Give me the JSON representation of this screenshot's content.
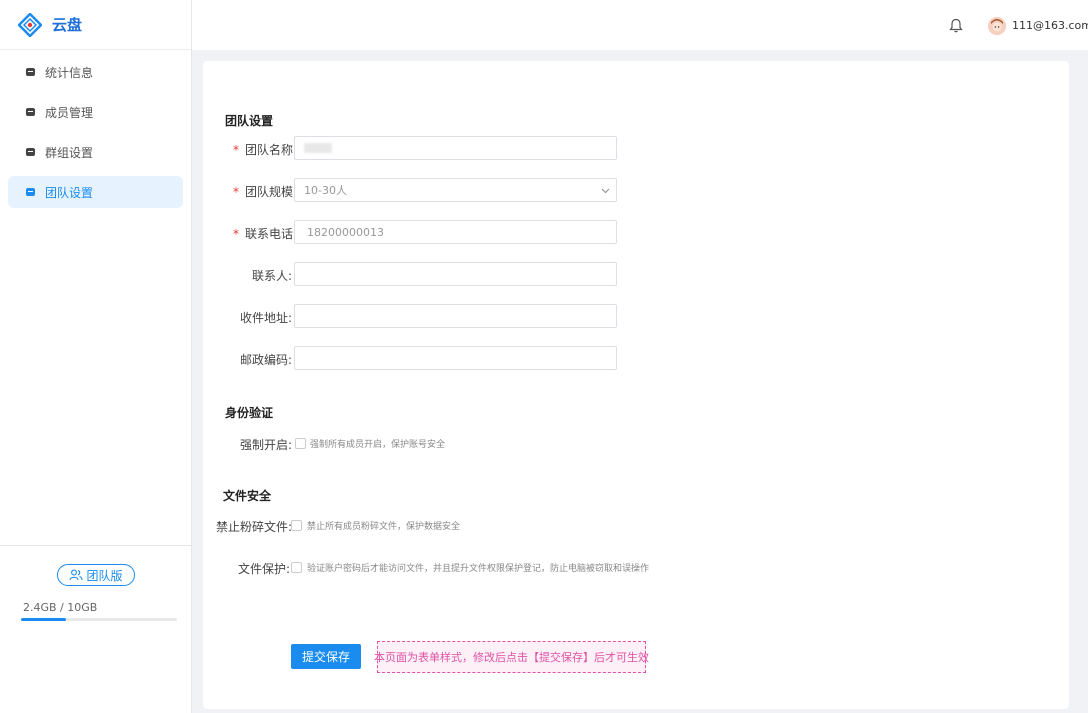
{
  "app": {
    "name": "云盘"
  },
  "sidebar": {
    "items": [
      {
        "label": "统计信息",
        "active": false
      },
      {
        "label": "成员管理",
        "active": false
      },
      {
        "label": "群组设置",
        "active": false
      },
      {
        "label": "团队设置",
        "active": true
      }
    ],
    "team_badge": "团队版",
    "storage_text": "2.4GB / 10GB",
    "storage_used_fraction": 0.29
  },
  "header": {
    "user_email": "111@163.com"
  },
  "form": {
    "section_team": "团队设置",
    "team_name_label": "团队名称:",
    "team_size_label": "团队规模:",
    "team_size_value": "10-30人",
    "phone_label": "联系电话:",
    "phone_value": "18200000013",
    "contact_label": "联系人:",
    "address_label": "收件地址:",
    "postcode_label": "邮政编码:",
    "section_identity": "身份验证",
    "force_enable_label": "强制开启:",
    "force_enable_text": "强制所有成员开启，保护账号安全",
    "section_file": "文件安全",
    "no_shred_label": "禁止粉碎文件:",
    "no_shred_text": "禁止所有成员粉碎文件，保护数据安全",
    "file_protect_label": "文件保护:",
    "file_protect_text": "验证账户密码后才能访问文件，并且提升文件权限保护登记，防止电脑被窃取和误操作",
    "submit_label": "提交保存",
    "notice_text": "本页面为表单样式，修改后点击【提交保存】后才可生效"
  },
  "colors": {
    "accent": "#1a8cf0",
    "required": "#e53935",
    "notice": "#e052a5"
  }
}
